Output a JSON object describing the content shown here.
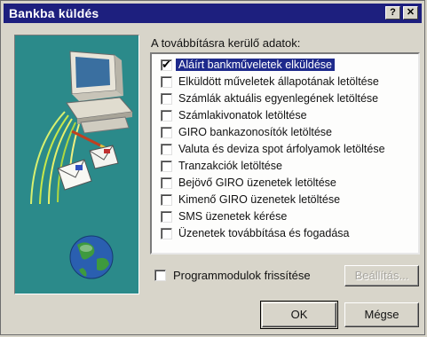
{
  "window": {
    "title": "Bankba küldés",
    "help_label": "?",
    "close_label": "✕"
  },
  "list": {
    "caption": "A továbbításra kerülő adatok:",
    "items": [
      {
        "label": "Aláírt bankműveletek elküldése",
        "checked": true,
        "selected": true
      },
      {
        "label": "Elküldött műveletek állapotának letöltése",
        "checked": false,
        "selected": false
      },
      {
        "label": "Számlák aktuális egyenlegének letöltése",
        "checked": false,
        "selected": false
      },
      {
        "label": "Számlakivonatok letöltése",
        "checked": false,
        "selected": false
      },
      {
        "label": "GIRO bankazonosítók letöltése",
        "checked": false,
        "selected": false
      },
      {
        "label": "Valuta és deviza spot árfolyamok letöltése",
        "checked": false,
        "selected": false
      },
      {
        "label": "Tranzakciók letöltése",
        "checked": false,
        "selected": false
      },
      {
        "label": "Bejövő GIRO üzenetek letöltése",
        "checked": false,
        "selected": false
      },
      {
        "label": "Kimenő GIRO üzenetek letöltése",
        "checked": false,
        "selected": false
      },
      {
        "label": "SMS üzenetek kérése",
        "checked": false,
        "selected": false
      },
      {
        "label": "Üzenetek továbbítása és fogadása",
        "checked": false,
        "selected": false
      }
    ]
  },
  "module_refresh": {
    "label": "Programmodulok frissítése",
    "checked": false
  },
  "buttons": {
    "settings": "Beállítás...",
    "ok": "OK",
    "cancel": "Mégse"
  },
  "colors": {
    "titlebar": "#1d1f7e",
    "art_background": "#2b8a8a",
    "selection": "#1e2a8c"
  }
}
